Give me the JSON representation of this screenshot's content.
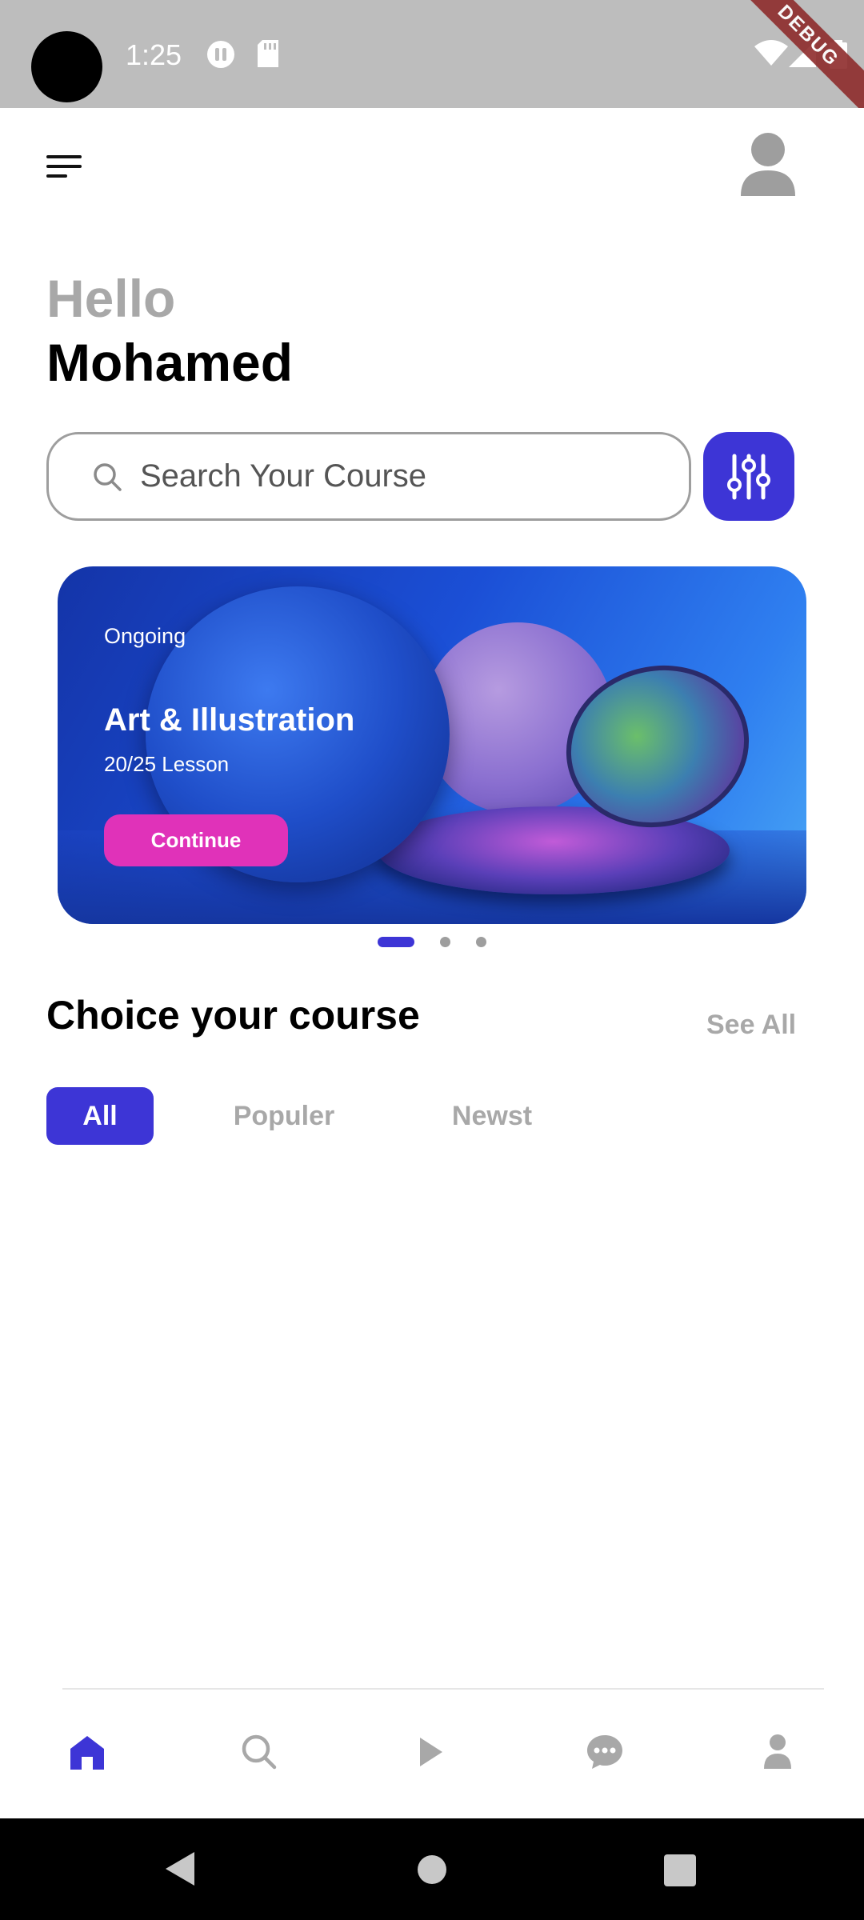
{
  "status_bar": {
    "time": "1:25",
    "debug_label": "DEBUG",
    "icons": [
      "headset-icon",
      "sd-card-icon",
      "wifi-icon",
      "signal-icon",
      "battery-icon"
    ]
  },
  "header": {
    "greeting": "Hello",
    "user_name": "Mohamed",
    "menu_icon": "menu-icon",
    "avatar_icon": "person-icon"
  },
  "search": {
    "placeholder": "Search Your Course",
    "filter_icon": "sliders-icon"
  },
  "banner": {
    "tag": "Ongoing",
    "title": "Art & Illustration",
    "progress": "20/25 Lesson",
    "button_label": "Continue",
    "page_count": 3,
    "active_page": 0
  },
  "courses_section": {
    "title": "Choice your course",
    "see_all_label": "See All",
    "filters": [
      "All",
      "Populer",
      "Newst"
    ],
    "selected_filter": "All"
  },
  "bottom_nav": {
    "items": [
      "home-icon",
      "search-icon",
      "play-icon",
      "chat-icon",
      "profile-icon"
    ],
    "active_item": "home-icon"
  },
  "colors": {
    "accent": "#3d35d6",
    "button_pink": "#e032b9",
    "muted_text": "#a8a8a8",
    "status_bar": "#bdbdbd"
  }
}
